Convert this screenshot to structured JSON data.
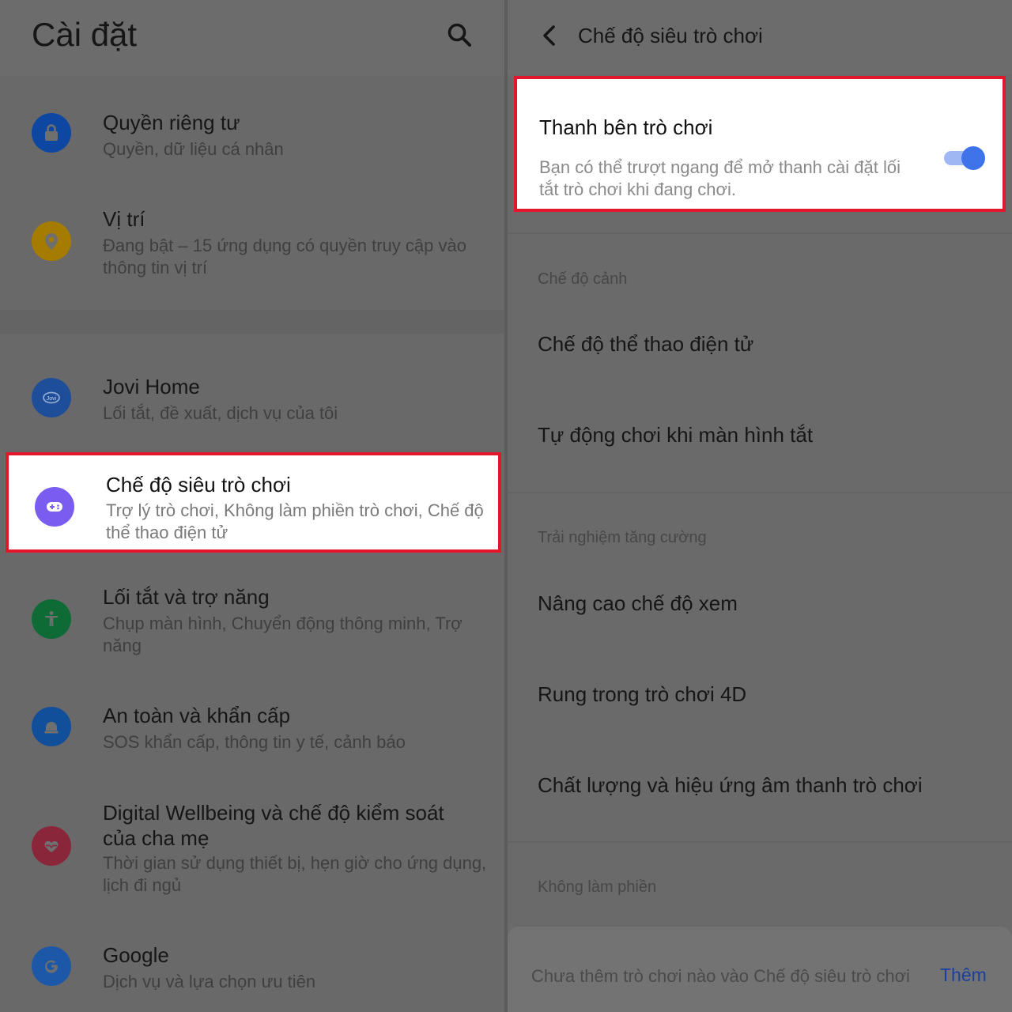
{
  "left": {
    "title": "Cài đặt",
    "items": [
      {
        "title": "Quyền riêng tư",
        "subtitle": "Quyền, dữ liệu cá nhân",
        "icon": "lock-icon",
        "color": "#0e47a1"
      },
      {
        "title": "Vị trí",
        "subtitle": "Đang bật – 15 ứng dụng có quyền truy cập vào thông tin vị trí",
        "icon": "location-pin-icon",
        "color": "#a67c00"
      },
      {
        "title": "Jovi Home",
        "subtitle": "Lối tắt, đề xuất, dịch vụ của tôi",
        "icon": "jovi-icon",
        "color": "#1e4e9a"
      },
      {
        "title": "Chế độ siêu trò chơi",
        "subtitle": "Trợ lý trò chơi, Không làm phiền trò chơi, Chế độ thể thao điện tử",
        "icon": "gamepad-icon",
        "color": "#7a5cf0"
      },
      {
        "title": "Lối tắt và trợ năng",
        "subtitle": "Chụp màn hình, Chuyển động thông minh, Trợ năng",
        "icon": "accessibility-icon",
        "color": "#0f6b36"
      },
      {
        "title": "An toàn và khẩn cấp",
        "subtitle": "SOS khẩn cấp, thông tin y tế, cảnh báo",
        "icon": "emergency-icon",
        "color": "#124f9b"
      },
      {
        "title": "Digital Wellbeing và chế độ kiểm soát của cha mẹ",
        "subtitle": "Thời gian sử dụng thiết bị, hẹn giờ cho ứng dụng, lịch đi ngủ",
        "icon": "heart-icon",
        "color": "#8a2639"
      },
      {
        "title": "Google",
        "subtitle": "Dịch vụ và lựa chọn ưu tiên",
        "icon": "google-icon",
        "color": "#1d58a8"
      }
    ]
  },
  "right": {
    "title": "Chế độ siêu trò chơi",
    "sidebar_card": {
      "title": "Thanh bên trò chơi",
      "subtitle": "Bạn có thể trượt ngang để mở thanh cài đặt lối tắt trò chơi khi đang chơi.",
      "toggle_on": true
    },
    "section_scene": "Chế độ cảnh",
    "row_esports": "Chế độ thể thao điện tử",
    "row_autoplay": "Tự động chơi khi màn hình tắt",
    "section_enhanced": "Trải nghiệm tăng cường",
    "row_viewing": "Nâng cao chế độ xem",
    "row_vibration": "Rung trong trò chơi 4D",
    "row_audio": "Chất lượng và hiệu ứng âm thanh trò chơi",
    "section_dnd": "Không làm phiền",
    "bottom_text": "Chưa thêm trò chơi nào vào Chế độ siêu trò chơi",
    "bottom_add": "Thêm"
  },
  "colors": {
    "highlight_border": "#e3172b",
    "toggle_accent": "#3f73ea",
    "add_link": "#1a3fa3"
  }
}
